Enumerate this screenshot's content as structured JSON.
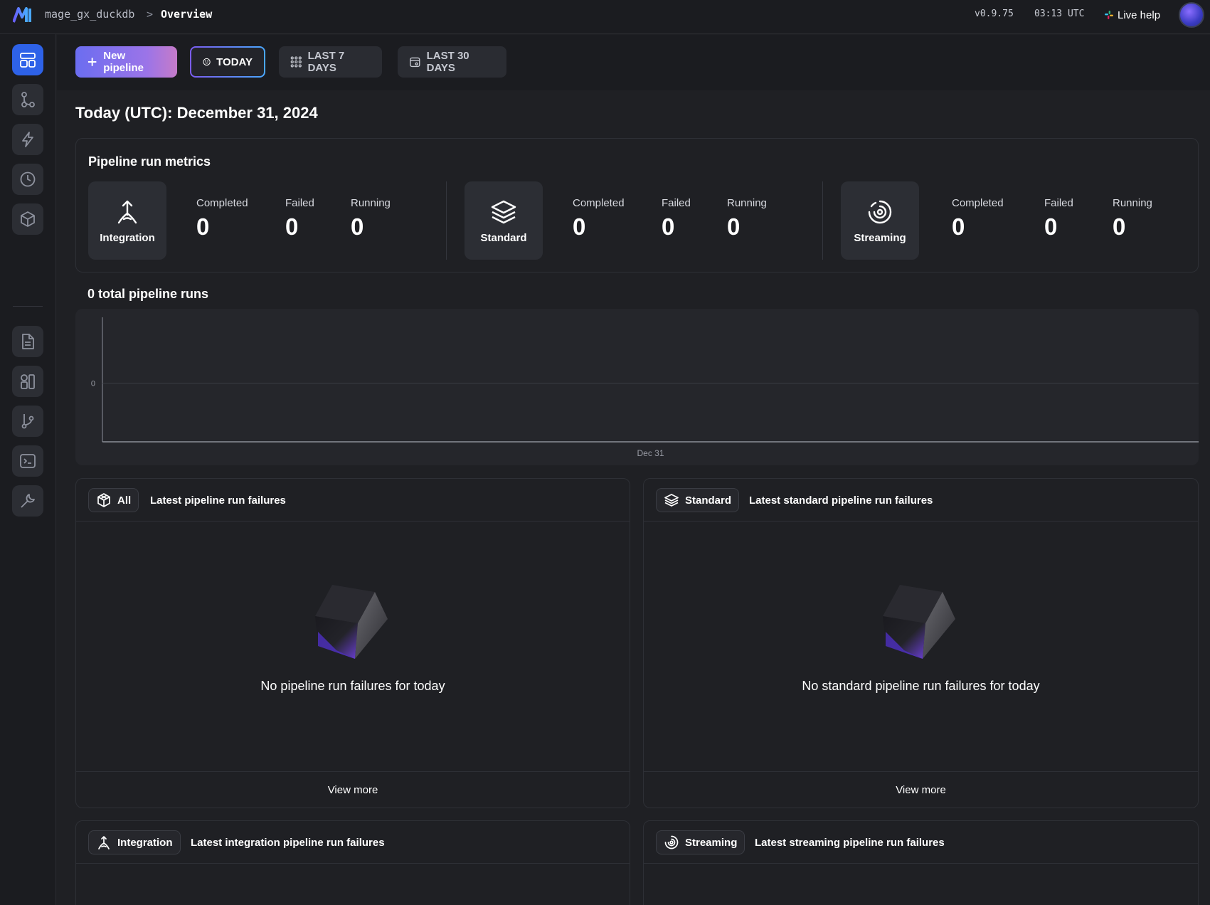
{
  "header": {
    "project": "mage_gx_duckdb",
    "separator": ">",
    "page": "Overview",
    "version": "v0.9.75",
    "time": "03:13 UTC",
    "live_help": "Live help"
  },
  "sidebar": {
    "items": [
      {
        "name": "overview",
        "icon": "layout-icon",
        "active": true
      },
      {
        "name": "pipelines",
        "icon": "pipeline-icon"
      },
      {
        "name": "triggers",
        "icon": "lightning-icon"
      },
      {
        "name": "pipeline-runs",
        "icon": "clock-icon"
      },
      {
        "name": "blocks",
        "icon": "cube-icon"
      },
      {
        "name": "files",
        "icon": "file-icon"
      },
      {
        "name": "templates",
        "icon": "shapes-icon"
      },
      {
        "name": "version-control",
        "icon": "branch-icon"
      },
      {
        "name": "terminal",
        "icon": "terminal-icon"
      },
      {
        "name": "settings",
        "icon": "wrench-icon"
      }
    ]
  },
  "toolbar": {
    "new_pipeline": "New pipeline",
    "today": "TODAY",
    "last_7_days": "LAST 7 DAYS",
    "last_30_days": "LAST 30 DAYS"
  },
  "main": {
    "title": "Today (UTC): December 31, 2024",
    "metrics": {
      "title": "Pipeline run metrics",
      "groups": [
        {
          "type": "Integration",
          "stats": [
            {
              "label": "Completed",
              "value": "0"
            },
            {
              "label": "Failed",
              "value": "0"
            },
            {
              "label": "Running",
              "value": "0"
            }
          ]
        },
        {
          "type": "Standard",
          "stats": [
            {
              "label": "Completed",
              "value": "0"
            },
            {
              "label": "Failed",
              "value": "0"
            },
            {
              "label": "Running",
              "value": "0"
            }
          ]
        },
        {
          "type": "Streaming",
          "stats": [
            {
              "label": "Completed",
              "value": "0"
            },
            {
              "label": "Failed",
              "value": "0"
            },
            {
              "label": "Running",
              "value": "0"
            }
          ]
        }
      ]
    },
    "runs_title": "0 total pipeline runs",
    "panels": [
      {
        "chip": "All",
        "title": "Latest pipeline run failures",
        "empty": "No pipeline run failures for today",
        "footer": "View more"
      },
      {
        "chip": "Standard",
        "title": "Latest standard pipeline run failures",
        "empty": "No standard pipeline run failures for today",
        "footer": "View more"
      },
      {
        "chip": "Integration",
        "title": "Latest integration pipeline run failures"
      },
      {
        "chip": "Streaming",
        "title": "Latest streaming pipeline run failures"
      }
    ]
  },
  "chart_data": {
    "type": "line",
    "title": "0 total pipeline runs",
    "x": [
      "Dec 31"
    ],
    "series": [
      {
        "values": [
          0
        ]
      }
    ],
    "y_ticks": [
      "0"
    ],
    "x_ticks": [
      "Dec 31"
    ],
    "grid": true,
    "colors": {
      "axis": "#8c8f98",
      "grid": "#3a3c43"
    }
  },
  "colors": {
    "background": "#1f2024",
    "sidebar": "#1b1c20",
    "accent_blue": "#2e62e8",
    "accent_purple": "#7b5cf0"
  }
}
